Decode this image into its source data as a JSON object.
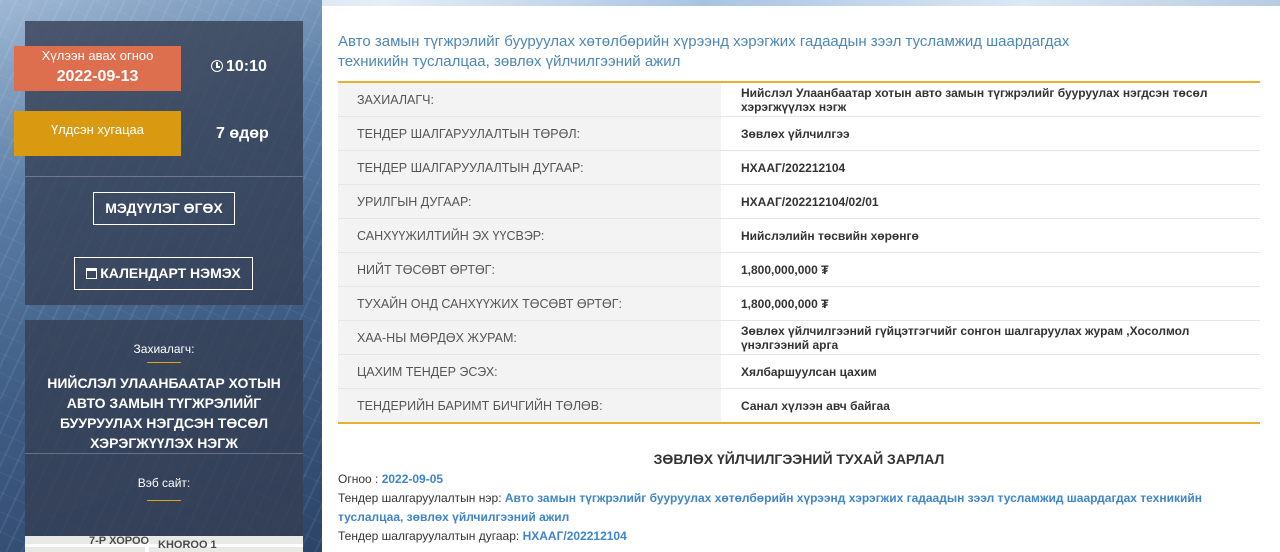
{
  "sidebar": {
    "deadline_label": "Хүлээн авах огноо",
    "deadline_date": "2022-09-13",
    "deadline_time": "10:10",
    "remaining_label": "Үлдсэн хугацаа",
    "remaining_value": "7 өдөр",
    "upload_button": "МЭДҮҮЛЭГ ӨГӨХ",
    "calendar_button": "КАЛЕНДАРТ НЭМЭХ",
    "client_label": "Захиалагч:",
    "client_name": "НИЙСЛЭЛ УЛААНБААТАР ХОТЫН АВТО ЗАМЫН ТҮГЖРЭЛИЙГ БУУРУУЛАХ НЭГДСЭН ТӨСӨЛ ХЭРЭГЖҮҮЛЭХ НЭГЖ",
    "website_label": "Вэб сайт:",
    "map_labels": [
      "7-Р ХОРОО",
      "KHOROO 1"
    ]
  },
  "main": {
    "title": "Авто замын түгжрэлийг бууруулах хөтөлбөрийн хүрээнд хэрэгжих гадаадын зээл тусламжид шаардагдах техникийн туслалцаа, зөвлөх үйлчилгээний ажил",
    "rows": [
      {
        "label": "ЗАХИАЛАГЧ:",
        "value": "Нийслэл Улаанбаатар хотын авто замын түгжрэлийг бууруулах нэгдсэн төсөл хэрэгжүүлэх нэгж"
      },
      {
        "label": "ТЕНДЕР ШАЛГАРУУЛАЛТЫН ТӨРӨЛ:",
        "value": "Зөвлөх үйлчилгээ"
      },
      {
        "label": "ТЕНДЕР ШАЛГАРУУЛАЛТЫН ДУГААР:",
        "value": "НХААГ/202212104"
      },
      {
        "label": "УРИЛГЫН ДУГААР:",
        "value": "НХААГ/202212104/02/01"
      },
      {
        "label": "САНХҮҮЖИЛТИЙН ЭХ ҮҮСВЭР:",
        "value": "Нийслэлийн төсвийн хөрөнгө"
      },
      {
        "label": "НИЙТ ТӨСӨВТ ӨРТӨГ:",
        "value": "1,800,000,000 ₮"
      },
      {
        "label": "ТУХАЙН ОНД САНХҮҮЖИХ ТӨСӨВТ ӨРТӨГ:",
        "value": "1,800,000,000 ₮"
      },
      {
        "label": "ХАА-НЫ МӨРДӨХ ЖУРАМ:",
        "value": "Зөвлөх үйлчилгээний гүйцэтгэгчийг сонгон шалгаруулах журам ,Хосолмол үнэлгээний арга"
      },
      {
        "label": "ЦАХИМ ТЕНДЕР ЭСЭХ:",
        "value": "Хялбаршуулсан цахим"
      },
      {
        "label": "ТЕНДЕРИЙН БАРИМТ БИЧГИЙН ТӨЛӨВ:",
        "value": "Санал хүлээн авч байгаа"
      }
    ],
    "section_heading": "ЗӨВЛӨХ ҮЙЛЧИЛГЭЭНИЙ ТУХАЙ ЗАРЛАЛ",
    "date_label": "Огноо : ",
    "date_value": "2022-09-05",
    "name_label": "Тендер шалгаруулалтын нэр: ",
    "name_value": "Авто замын түгжрэлийг бууруулах хөтөлбөрийн хүрээнд хэрэгжих гадаадын зээл тусламжид шаардагдах техникийн туслалцаа, зөвлөх үйлчилгээний ажил",
    "number_label": "Тендер шалгаруулалтын дугаар: ",
    "number_value": "НХААГ/202212104"
  }
}
